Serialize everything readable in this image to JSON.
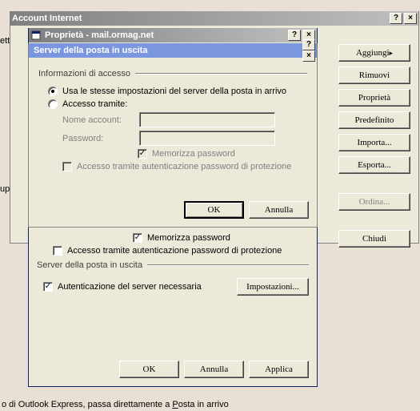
{
  "parent_window": {
    "title": "Account Internet",
    "buttons": {
      "add": "Aggiungi",
      "remove": "Rimuovi",
      "properties": "Proprietà",
      "default": "Predefinito",
      "import": "Importa...",
      "export": "Esporta...",
      "order": "Ordina...",
      "close": "Chiudi"
    }
  },
  "prop_window": {
    "title": "Proprietà - mail.ormag.net",
    "lower": {
      "remember_pw": "Memorizza password",
      "spa": "Accesso tramite autenticazione password di protezione",
      "group": "Server della posta in uscita",
      "auth_required": "Autenticazione del server necessaria",
      "settings": "Impostazioni..."
    },
    "buttons": {
      "ok": "OK",
      "cancel": "Annulla",
      "apply": "Applica"
    }
  },
  "smtp_dialog": {
    "title": "Server della posta in uscita",
    "group": "Informazioni di accesso",
    "use_same": "Usa le stesse impostazioni del server della posta in arrivo",
    "logon_using": "Accesso tramite:",
    "account_name": "Nome account:",
    "password": "Password:",
    "remember_pw": "Memorizza password",
    "spa": "Accesso tramite autenticazione password di protezione",
    "buttons": {
      "ok": "OK",
      "cancel": "Annulla"
    }
  },
  "footer": {
    "prefix": "o di Outlook Express, passa direttamente a ",
    "link_letter": "P",
    "link_rest": "osta in arrivo"
  },
  "left_fragment": {
    "t1": "ett",
    "t2": "up"
  }
}
